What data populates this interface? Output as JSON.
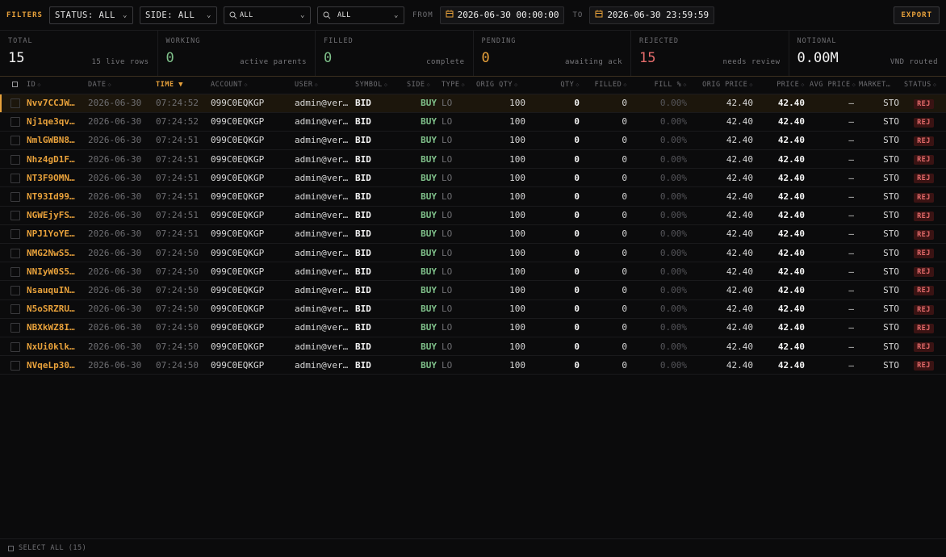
{
  "filters": {
    "title": "FILTERS",
    "status": "STATUS: ALL",
    "side": "SIDE: ALL",
    "search1": "ALL",
    "search2": "ALL",
    "from_label": "FROM",
    "from_value": "2026-06-30 00:00:00",
    "to_label": "TO",
    "to_value": "2026-06-30 23:59:59",
    "export": "EXPORT"
  },
  "stats": [
    {
      "title": "TOTAL",
      "value": "15",
      "sub": "15 live rows"
    },
    {
      "title": "WORKING",
      "value": "0",
      "sub": "active parents"
    },
    {
      "title": "FILLED",
      "value": "0",
      "sub": "complete"
    },
    {
      "title": "PENDING",
      "value": "0",
      "sub": "awaiting ack"
    },
    {
      "title": "REJECTED",
      "value": "15",
      "sub": "needs review"
    },
    {
      "title": "NOTIONAL",
      "value": "0.00M",
      "sub": "VND routed"
    }
  ],
  "columns": [
    {
      "key": "id",
      "label": "ID"
    },
    {
      "key": "date",
      "label": "DATE"
    },
    {
      "key": "time",
      "label": "TIME"
    },
    {
      "key": "account",
      "label": "ACCOUNT"
    },
    {
      "key": "user",
      "label": "USER"
    },
    {
      "key": "symbol",
      "label": "SYMBOL"
    },
    {
      "key": "side",
      "label": "SIDE"
    },
    {
      "key": "type",
      "label": "TYPE"
    },
    {
      "key": "orig_qty",
      "label": "ORIG QTY"
    },
    {
      "key": "qty",
      "label": "QTY"
    },
    {
      "key": "filled",
      "label": "FILLED"
    },
    {
      "key": "fill_pct",
      "label": "FILL %"
    },
    {
      "key": "orig_price",
      "label": "ORIG PRICE"
    },
    {
      "key": "price",
      "label": "PRICE"
    },
    {
      "key": "avg_price",
      "label": "AVG PRICE"
    },
    {
      "key": "market",
      "label": "MARKET…"
    },
    {
      "key": "status",
      "label": "STATUS"
    }
  ],
  "sort_arrow": "▼",
  "sort_neutral": "◇",
  "rows": [
    {
      "id": "Nvv7CCJW…",
      "date": "2026-06-30",
      "time": "07:24:52",
      "account": "099C0EQKGP",
      "user": "admin@ver…",
      "symbol": "BID",
      "side": "BUY",
      "type": "LO",
      "orig_qty": "100",
      "qty": "0",
      "filled": "0",
      "fill_pct": "0.00%",
      "orig_price": "42.40",
      "price": "42.40",
      "avg_price": "—",
      "market": "STO",
      "status": "REJ"
    },
    {
      "id": "Nj1qe3qv…",
      "date": "2026-06-30",
      "time": "07:24:52",
      "account": "099C0EQKGP",
      "user": "admin@ver…",
      "symbol": "BID",
      "side": "BUY",
      "type": "LO",
      "orig_qty": "100",
      "qty": "0",
      "filled": "0",
      "fill_pct": "0.00%",
      "orig_price": "42.40",
      "price": "42.40",
      "avg_price": "—",
      "market": "STO",
      "status": "REJ"
    },
    {
      "id": "NmlGWBN8…",
      "date": "2026-06-30",
      "time": "07:24:51",
      "account": "099C0EQKGP",
      "user": "admin@ver…",
      "symbol": "BID",
      "side": "BUY",
      "type": "LO",
      "orig_qty": "100",
      "qty": "0",
      "filled": "0",
      "fill_pct": "0.00%",
      "orig_price": "42.40",
      "price": "42.40",
      "avg_price": "—",
      "market": "STO",
      "status": "REJ"
    },
    {
      "id": "Nhz4gD1F…",
      "date": "2026-06-30",
      "time": "07:24:51",
      "account": "099C0EQKGP",
      "user": "admin@ver…",
      "symbol": "BID",
      "side": "BUY",
      "type": "LO",
      "orig_qty": "100",
      "qty": "0",
      "filled": "0",
      "fill_pct": "0.00%",
      "orig_price": "42.40",
      "price": "42.40",
      "avg_price": "—",
      "market": "STO",
      "status": "REJ"
    },
    {
      "id": "NT3F9OMN…",
      "date": "2026-06-30",
      "time": "07:24:51",
      "account": "099C0EQKGP",
      "user": "admin@ver…",
      "symbol": "BID",
      "side": "BUY",
      "type": "LO",
      "orig_qty": "100",
      "qty": "0",
      "filled": "0",
      "fill_pct": "0.00%",
      "orig_price": "42.40",
      "price": "42.40",
      "avg_price": "—",
      "market": "STO",
      "status": "REJ"
    },
    {
      "id": "NT93Id99…",
      "date": "2026-06-30",
      "time": "07:24:51",
      "account": "099C0EQKGP",
      "user": "admin@ver…",
      "symbol": "BID",
      "side": "BUY",
      "type": "LO",
      "orig_qty": "100",
      "qty": "0",
      "filled": "0",
      "fill_pct": "0.00%",
      "orig_price": "42.40",
      "price": "42.40",
      "avg_price": "—",
      "market": "STO",
      "status": "REJ"
    },
    {
      "id": "NGWEjyFS…",
      "date": "2026-06-30",
      "time": "07:24:51",
      "account": "099C0EQKGP",
      "user": "admin@ver…",
      "symbol": "BID",
      "side": "BUY",
      "type": "LO",
      "orig_qty": "100",
      "qty": "0",
      "filled": "0",
      "fill_pct": "0.00%",
      "orig_price": "42.40",
      "price": "42.40",
      "avg_price": "—",
      "market": "STO",
      "status": "REJ"
    },
    {
      "id": "NPJ1YoYE…",
      "date": "2026-06-30",
      "time": "07:24:51",
      "account": "099C0EQKGP",
      "user": "admin@ver…",
      "symbol": "BID",
      "side": "BUY",
      "type": "LO",
      "orig_qty": "100",
      "qty": "0",
      "filled": "0",
      "fill_pct": "0.00%",
      "orig_price": "42.40",
      "price": "42.40",
      "avg_price": "—",
      "market": "STO",
      "status": "REJ"
    },
    {
      "id": "NMG2NwS5…",
      "date": "2026-06-30",
      "time": "07:24:50",
      "account": "099C0EQKGP",
      "user": "admin@ver…",
      "symbol": "BID",
      "side": "BUY",
      "type": "LO",
      "orig_qty": "100",
      "qty": "0",
      "filled": "0",
      "fill_pct": "0.00%",
      "orig_price": "42.40",
      "price": "42.40",
      "avg_price": "—",
      "market": "STO",
      "status": "REJ"
    },
    {
      "id": "NNIyW0S5…",
      "date": "2026-06-30",
      "time": "07:24:50",
      "account": "099C0EQKGP",
      "user": "admin@ver…",
      "symbol": "BID",
      "side": "BUY",
      "type": "LO",
      "orig_qty": "100",
      "qty": "0",
      "filled": "0",
      "fill_pct": "0.00%",
      "orig_price": "42.40",
      "price": "42.40",
      "avg_price": "—",
      "market": "STO",
      "status": "REJ"
    },
    {
      "id": "NsauquIN…",
      "date": "2026-06-30",
      "time": "07:24:50",
      "account": "099C0EQKGP",
      "user": "admin@ver…",
      "symbol": "BID",
      "side": "BUY",
      "type": "LO",
      "orig_qty": "100",
      "qty": "0",
      "filled": "0",
      "fill_pct": "0.00%",
      "orig_price": "42.40",
      "price": "42.40",
      "avg_price": "—",
      "market": "STO",
      "status": "REJ"
    },
    {
      "id": "N5oSRZRU…",
      "date": "2026-06-30",
      "time": "07:24:50",
      "account": "099C0EQKGP",
      "user": "admin@ver…",
      "symbol": "BID",
      "side": "BUY",
      "type": "LO",
      "orig_qty": "100",
      "qty": "0",
      "filled": "0",
      "fill_pct": "0.00%",
      "orig_price": "42.40",
      "price": "42.40",
      "avg_price": "—",
      "market": "STO",
      "status": "REJ"
    },
    {
      "id": "NBXkWZ8I…",
      "date": "2026-06-30",
      "time": "07:24:50",
      "account": "099C0EQKGP",
      "user": "admin@ver…",
      "symbol": "BID",
      "side": "BUY",
      "type": "LO",
      "orig_qty": "100",
      "qty": "0",
      "filled": "0",
      "fill_pct": "0.00%",
      "orig_price": "42.40",
      "price": "42.40",
      "avg_price": "—",
      "market": "STO",
      "status": "REJ"
    },
    {
      "id": "NxUi0klk…",
      "date": "2026-06-30",
      "time": "07:24:50",
      "account": "099C0EQKGP",
      "user": "admin@ver…",
      "symbol": "BID",
      "side": "BUY",
      "type": "LO",
      "orig_qty": "100",
      "qty": "0",
      "filled": "0",
      "fill_pct": "0.00%",
      "orig_price": "42.40",
      "price": "42.40",
      "avg_price": "—",
      "market": "STO",
      "status": "REJ"
    },
    {
      "id": "NVqeLp30…",
      "date": "2026-06-30",
      "time": "07:24:50",
      "account": "099C0EQKGP",
      "user": "admin@ver…",
      "symbol": "BID",
      "side": "BUY",
      "type": "LO",
      "orig_qty": "100",
      "qty": "0",
      "filled": "0",
      "fill_pct": "0.00%",
      "orig_price": "42.40",
      "price": "42.40",
      "avg_price": "—",
      "market": "STO",
      "status": "REJ"
    }
  ],
  "footer": {
    "select_all": "SELECT ALL (15)"
  },
  "colors": {
    "accent": "#e9a23b",
    "buy": "#7fc08a",
    "rejected": "#e56b6b",
    "background": "#0b0b0c"
  }
}
